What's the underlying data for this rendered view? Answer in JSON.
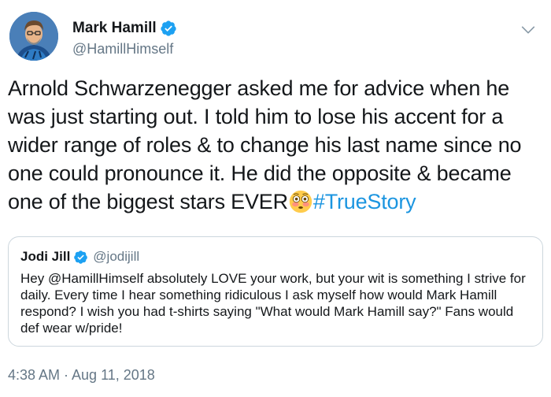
{
  "author": {
    "display_name": "Mark Hamill",
    "handle": "@HamillHimself",
    "verified": true
  },
  "tweet": {
    "text": "Arnold Schwarzenegger asked me for advice when he was just starting out. I told him to lose his accent for a wider range of roles & to change his last name since no one could pronounce it. He did the opposite & became one of the biggest stars EVER",
    "emoji": "flushed-face-emoji",
    "hashtag": "#TrueStory",
    "timestamp": "4:38 AM · Aug 11, 2018"
  },
  "quoted_tweet": {
    "display_name": "Jodi Jill",
    "handle": "@jodijill",
    "verified": true,
    "text": "Hey @HamillHimself absolutely LOVE your work, but your wit is something I strive for daily. Every time I hear something ridiculous I ask myself how would Mark Hamill respond? I wish you had t-shirts saying \"What would Mark Hamill say?\" Fans would def wear w/pride!"
  },
  "icons": {
    "verified": "verified-badge-icon",
    "menu": "chevron-down-icon"
  },
  "colors": {
    "link": "#1b95e0",
    "secondary_text": "#657786",
    "border": "#ccd6dd",
    "verified": "#1da1f2"
  }
}
